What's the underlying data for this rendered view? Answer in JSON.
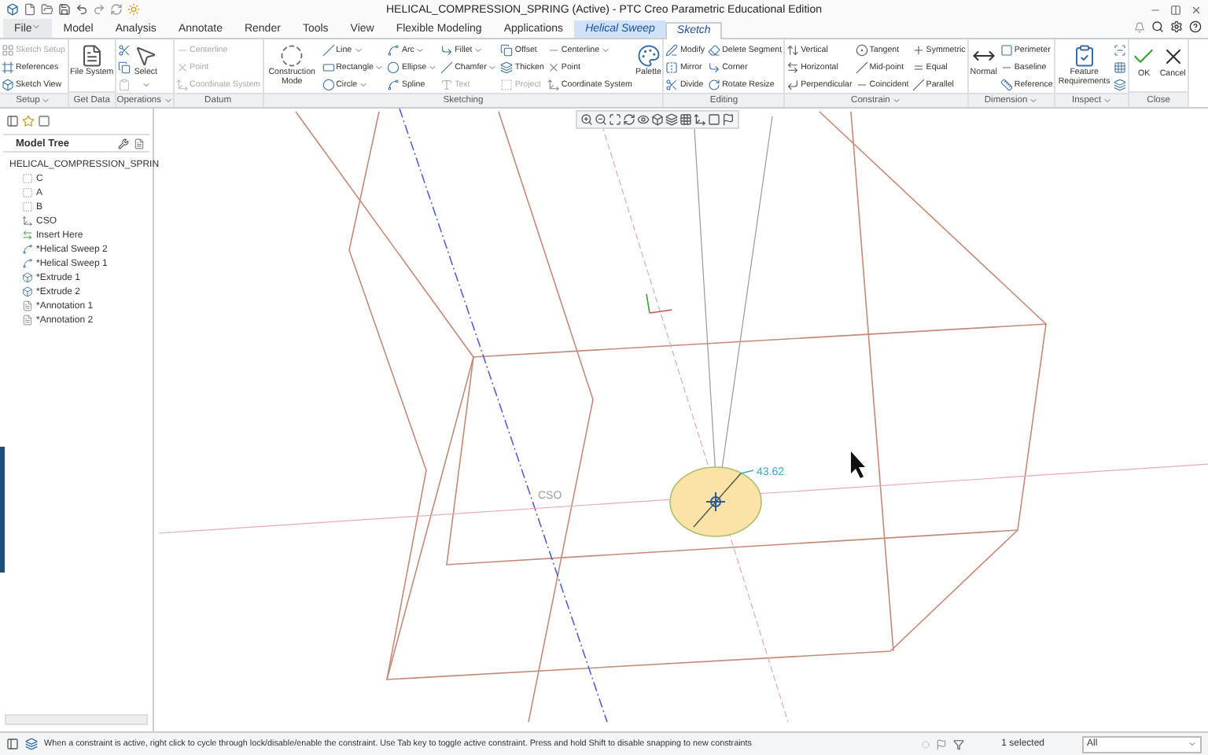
{
  "window": {
    "title": "HELICAL_COMPRESSION_SPRING (Active) - PTC Creo Parametric Educational Edition"
  },
  "tabs": [
    {
      "label": "File",
      "kind": "file",
      "selected": false
    },
    {
      "label": "Model",
      "kind": "tab",
      "selected": false
    },
    {
      "label": "Analysis",
      "kind": "tab",
      "selected": false
    },
    {
      "label": "Annotate",
      "kind": "tab",
      "selected": false
    },
    {
      "label": "Render",
      "kind": "tab",
      "selected": false
    },
    {
      "label": "Tools",
      "kind": "tab",
      "selected": false
    },
    {
      "label": "View",
      "kind": "tab",
      "selected": false
    },
    {
      "label": "Flexible Modeling",
      "kind": "tab",
      "selected": false
    },
    {
      "label": "Applications",
      "kind": "tab",
      "selected": false
    },
    {
      "label": "Helical Sweep",
      "kind": "context",
      "selected": false
    },
    {
      "label": "Sketch",
      "kind": "context",
      "selected": true
    }
  ],
  "ribbon": {
    "groups": [
      {
        "label": "Setup",
        "has_menu": true,
        "columns": [
          [
            {
              "label": "Sketch Setup",
              "kind": "small",
              "disabled": true,
              "dropdown": false
            },
            {
              "label": "References",
              "kind": "small",
              "disabled": false,
              "dropdown": false
            },
            {
              "label": "Sketch View",
              "kind": "small",
              "disabled": false,
              "dropdown": false
            }
          ]
        ]
      },
      {
        "label": "Get Data",
        "has_menu": false,
        "columns": [
          [
            {
              "label": "File System",
              "kind": "large",
              "disabled": false,
              "dropdown": false
            }
          ]
        ]
      },
      {
        "label": "Operations",
        "has_menu": true,
        "columns": [
          [
            {
              "kind": "icon",
              "disabled": false,
              "dropdown": false
            },
            {
              "kind": "icon",
              "disabled": false,
              "dropdown": false
            },
            {
              "kind": "icon",
              "disabled": true,
              "dropdown": false
            }
          ],
          [
            {
              "label": "Select",
              "kind": "large",
              "disabled": false,
              "dropdown": true
            }
          ]
        ]
      },
      {
        "label": "Datum",
        "has_menu": false,
        "columns": [
          [
            {
              "label": "Centerline",
              "kind": "small",
              "disabled": true,
              "dropdown": false
            },
            {
              "label": "Point",
              "kind": "small",
              "disabled": true,
              "dropdown": false
            },
            {
              "label": "Coordinate System",
              "kind": "small",
              "disabled": true,
              "dropdown": false
            }
          ]
        ]
      },
      {
        "label": "Sketching",
        "has_menu": false,
        "columns": [
          [
            {
              "label": "Construction Mode",
              "kind": "large",
              "disabled": false,
              "dropdown": false
            }
          ],
          [
            {
              "label": "Line",
              "kind": "small",
              "disabled": false,
              "dropdown": true
            },
            {
              "label": "Rectangle",
              "kind": "small",
              "disabled": false,
              "dropdown": true
            },
            {
              "label": "Circle",
              "kind": "small",
              "disabled": false,
              "dropdown": true
            }
          ],
          [
            {
              "label": "Arc",
              "kind": "small",
              "disabled": false,
              "dropdown": true
            },
            {
              "label": "Ellipse",
              "kind": "small",
              "disabled": false,
              "dropdown": true
            },
            {
              "label": "Spline",
              "kind": "small",
              "disabled": false,
              "dropdown": false
            }
          ],
          [
            {
              "label": "Fillet",
              "kind": "small",
              "disabled": false,
              "dropdown": true
            },
            {
              "label": "Chamfer",
              "kind": "small",
              "disabled": false,
              "dropdown": true
            },
            {
              "label": "Text",
              "kind": "small",
              "disabled": true,
              "dropdown": false
            }
          ],
          [
            {
              "label": "Offset",
              "kind": "small",
              "disabled": false,
              "dropdown": false
            },
            {
              "label": "Thicken",
              "kind": "small",
              "disabled": false,
              "dropdown": false
            },
            {
              "label": "Project",
              "kind": "small",
              "disabled": true,
              "dropdown": false
            }
          ],
          [
            {
              "label": "Centerline",
              "kind": "small",
              "disabled": false,
              "dropdown": true
            },
            {
              "label": "Point",
              "kind": "small",
              "disabled": false,
              "dropdown": false
            },
            {
              "label": "Coordinate System",
              "kind": "small",
              "disabled": false,
              "dropdown": false
            }
          ],
          [
            {
              "label": "Palette",
              "kind": "large",
              "disabled": false,
              "dropdown": false
            }
          ]
        ]
      },
      {
        "label": "Editing",
        "has_menu": false,
        "columns": [
          [
            {
              "label": "Modify",
              "kind": "small",
              "disabled": false,
              "dropdown": false
            },
            {
              "label": "Mirror",
              "kind": "small",
              "disabled": false,
              "dropdown": false
            },
            {
              "label": "Divide",
              "kind": "small",
              "disabled": false,
              "dropdown": false
            }
          ],
          [
            {
              "label": "Delete Segment",
              "kind": "small",
              "disabled": false,
              "dropdown": false
            },
            {
              "label": "Corner",
              "kind": "small",
              "disabled": false,
              "dropdown": false
            },
            {
              "label": "Rotate Resize",
              "kind": "small",
              "disabled": false,
              "dropdown": false
            }
          ]
        ]
      },
      {
        "label": "Constrain",
        "has_menu": true,
        "columns": [
          [
            {
              "label": "Vertical",
              "kind": "small",
              "disabled": false,
              "dropdown": false
            },
            {
              "label": "Horizontal",
              "kind": "small",
              "disabled": false,
              "dropdown": false
            },
            {
              "label": "Perpendicular",
              "kind": "small",
              "disabled": false,
              "dropdown": false
            }
          ],
          [
            {
              "label": "Tangent",
              "kind": "small",
              "disabled": false,
              "dropdown": false
            },
            {
              "label": "Mid-point",
              "kind": "small",
              "disabled": false,
              "dropdown": false
            },
            {
              "label": "Coincident",
              "kind": "small",
              "disabled": false,
              "dropdown": false
            }
          ],
          [
            {
              "label": "Symmetric",
              "kind": "small",
              "disabled": false,
              "dropdown": false
            },
            {
              "label": "Equal",
              "kind": "small",
              "disabled": false,
              "dropdown": false
            },
            {
              "label": "Parallel",
              "kind": "small",
              "disabled": false,
              "dropdown": false
            }
          ]
        ]
      },
      {
        "label": "Dimension",
        "has_menu": true,
        "columns": [
          [
            {
              "label": "Normal",
              "kind": "large",
              "disabled": false,
              "dropdown": false
            }
          ],
          [
            {
              "label": "Perimeter",
              "kind": "small",
              "disabled": false,
              "dropdown": false
            },
            {
              "label": "Baseline",
              "kind": "small",
              "disabled": false,
              "dropdown": false
            },
            {
              "label": "Reference",
              "kind": "small",
              "disabled": false,
              "dropdown": false
            }
          ]
        ]
      },
      {
        "label": "Inspect",
        "has_menu": true,
        "columns": [
          [
            {
              "label": "Feature Requirements",
              "kind": "large",
              "disabled": false,
              "dropdown": false
            }
          ],
          [
            {
              "kind": "icon",
              "disabled": false,
              "dropdown": false
            },
            {
              "kind": "icon",
              "disabled": false,
              "dropdown": false
            },
            {
              "kind": "icon",
              "disabled": false,
              "dropdown": false
            }
          ]
        ]
      },
      {
        "label": "Close",
        "has_menu": false,
        "columns": [
          [
            {
              "label": "OK",
              "kind": "large",
              "disabled": false,
              "dropdown": false
            }
          ],
          [
            {
              "label": "Cancel",
              "kind": "large",
              "disabled": false,
              "dropdown": false
            }
          ]
        ]
      }
    ]
  },
  "model_tree": {
    "title": "Model Tree",
    "items": [
      {
        "label": "HELICAL_COMPRESSION_SPRIN",
        "kind": "part",
        "children": [
          {
            "label": "C",
            "kind": "plane"
          },
          {
            "label": "A",
            "kind": "plane"
          },
          {
            "label": "B",
            "kind": "plane"
          },
          {
            "label": "CSO",
            "kind": "csys"
          },
          {
            "label": "Insert Here",
            "kind": "insert"
          },
          {
            "label": "*Helical Sweep 2",
            "kind": "sweep"
          },
          {
            "label": "*Helical Sweep 1",
            "kind": "sweep"
          },
          {
            "label": "*Extrude 1",
            "kind": "extrude"
          },
          {
            "label": "*Extrude 2",
            "kind": "extrude"
          },
          {
            "label": "*Annotation 1",
            "kind": "annotation"
          },
          {
            "label": "*Annotation 2",
            "kind": "annotation"
          }
        ]
      }
    ]
  },
  "canvas": {
    "dimension": "43.62",
    "csys_label": "CSO"
  },
  "status_bar": {
    "message": "When a constraint is active, right click to cycle through lock/disable/enable the constraint. Use Tab key to toggle active constraint. Press and hold Shift to disable snapping to new constraints",
    "selection": "1 selected",
    "filter": "All"
  }
}
